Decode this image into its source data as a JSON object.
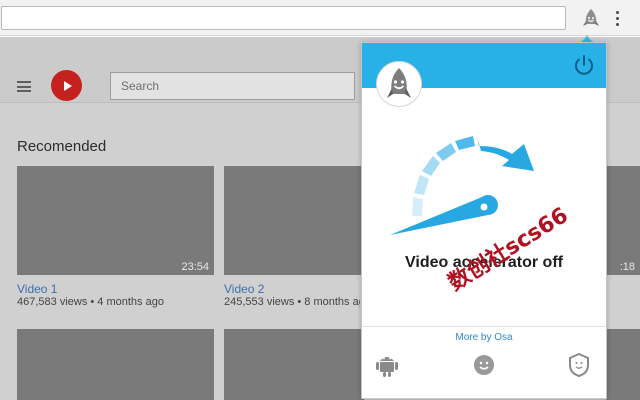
{
  "browser": {
    "address_bar_value": "",
    "extension_icon": "rocket-face-icon",
    "menu_icon": "vertical-dots-icon"
  },
  "youtube": {
    "search_placeholder": "Search",
    "section_title": "Recomended",
    "videos": [
      {
        "title": "Video 1",
        "meta": "467,583 views • 4 months ago",
        "duration": "23:54"
      },
      {
        "title": "Video 2",
        "meta": "245,553 views • 8 months ago",
        "duration": ""
      },
      {
        "title": "",
        "meta": "",
        "duration": ":18"
      }
    ]
  },
  "popup": {
    "status_text": "Video accelerator off",
    "more_link": "More by Osa",
    "accent_color": "#27b1e7",
    "footer_icons": [
      "android-icon",
      "rocket-face-icon",
      "shield-icon"
    ]
  },
  "watermark": "数创社scs66"
}
